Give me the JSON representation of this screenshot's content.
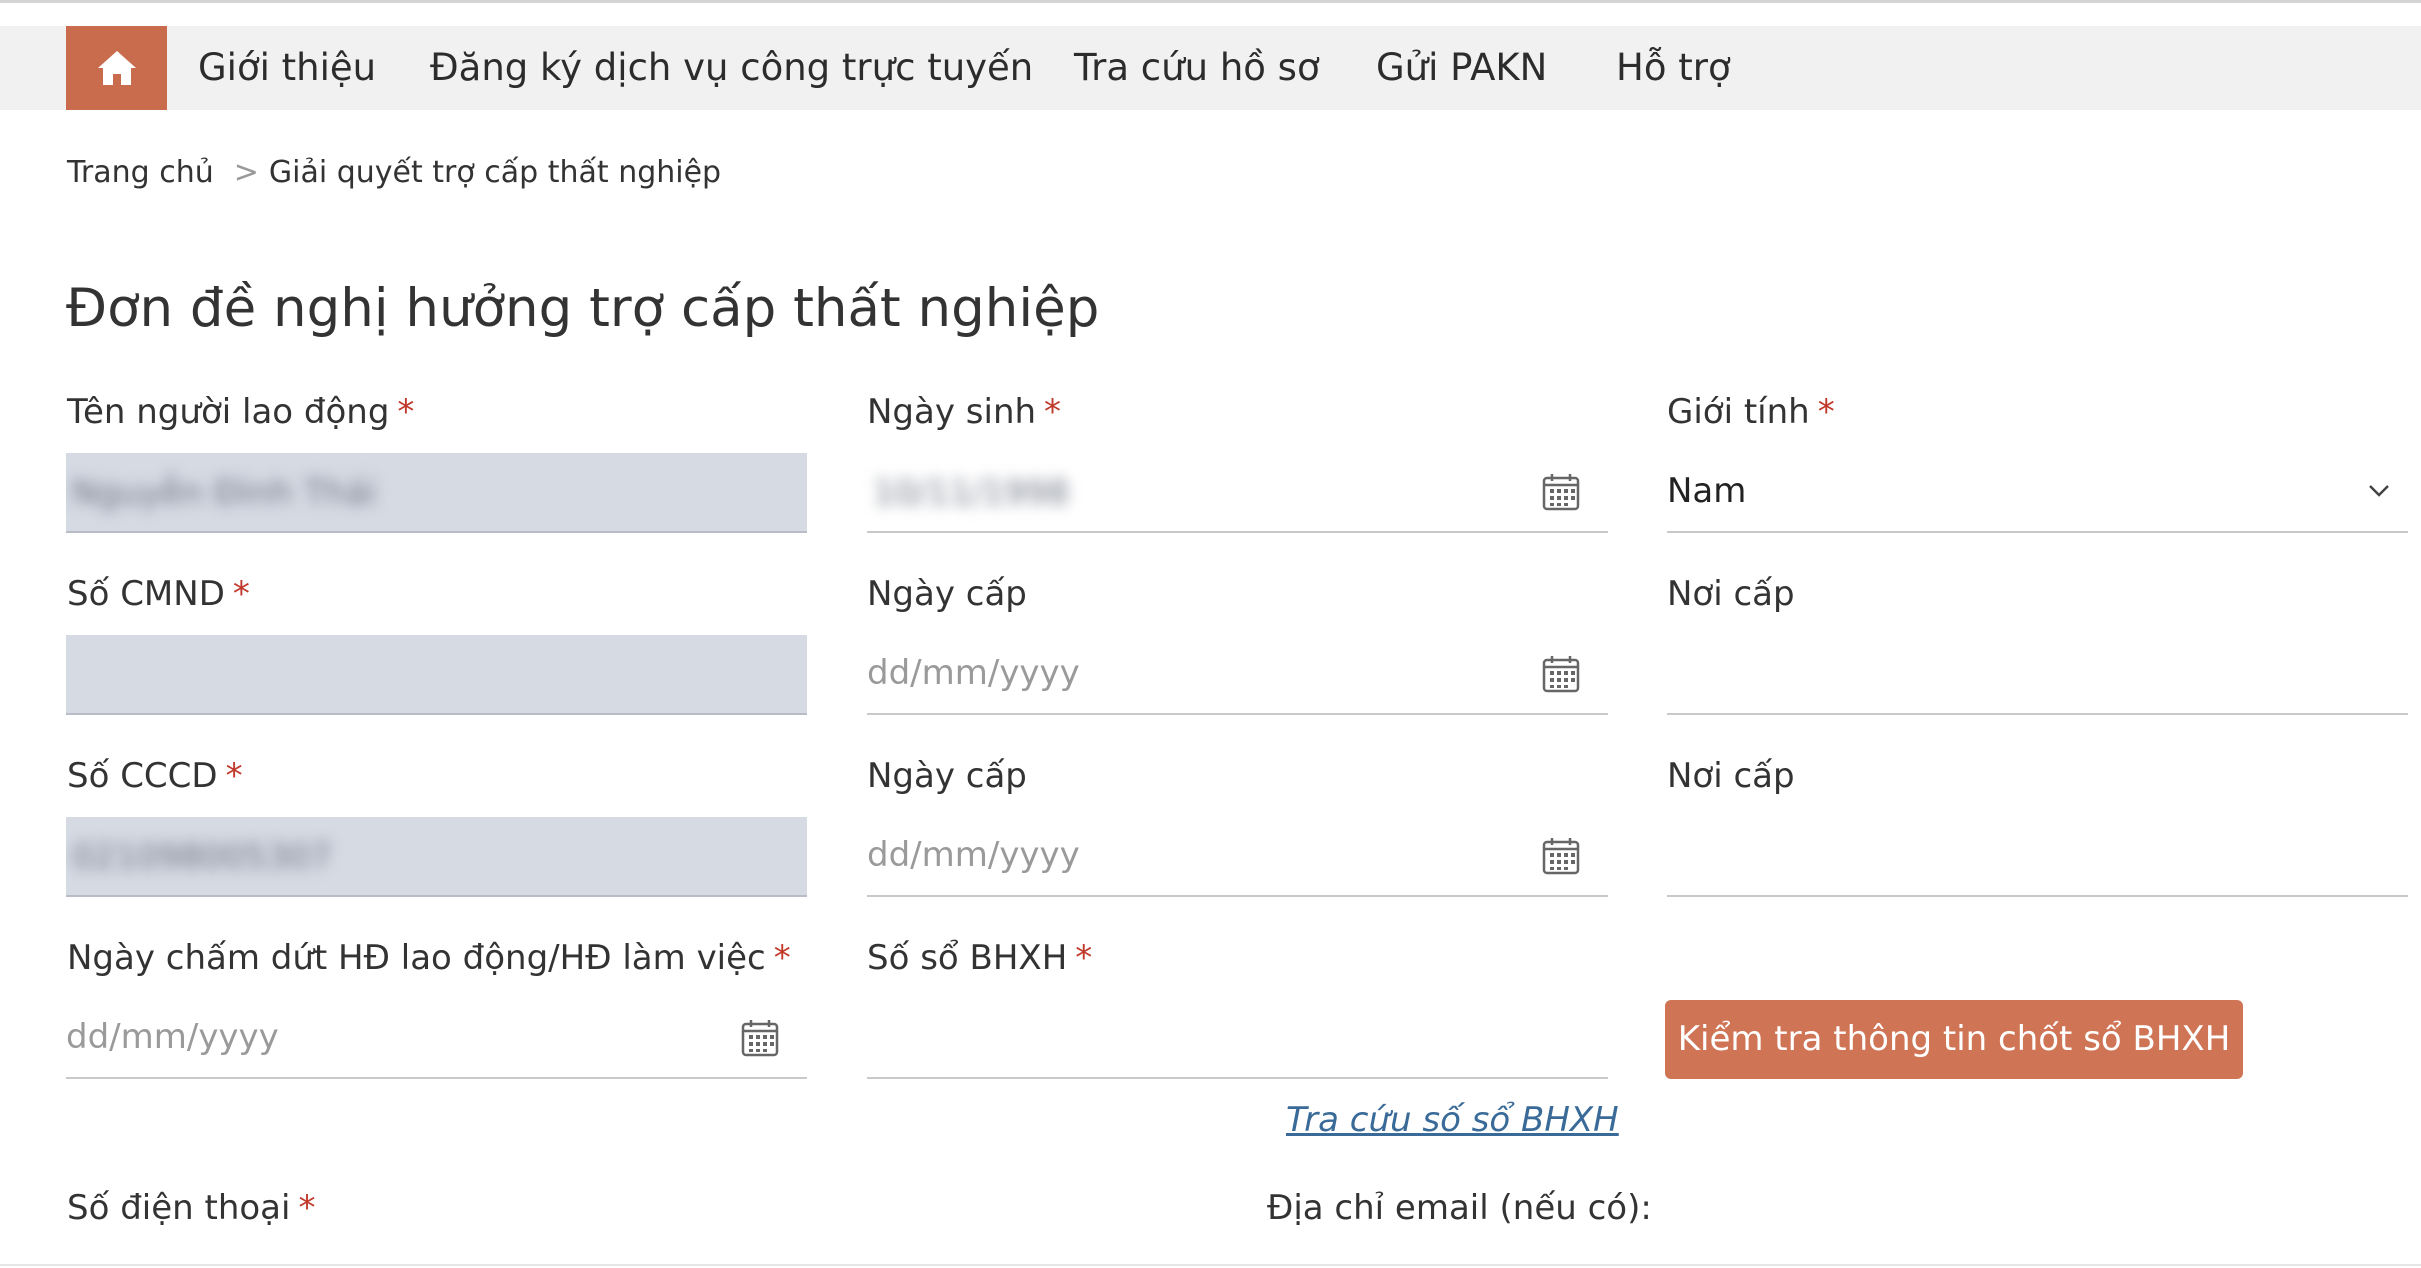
{
  "nav": {
    "items": [
      {
        "label": "Giới thiệu"
      },
      {
        "label": "Đăng ký dịch vụ công trực tuyến"
      },
      {
        "label": "Tra cứu hồ sơ"
      },
      {
        "label": "Gửi PAKN"
      },
      {
        "label": "Hỗ trợ"
      }
    ]
  },
  "breadcrumb": {
    "home": "Trang chủ",
    "separator": ">",
    "current": "Giải quyết trợ cấp thất nghiệp"
  },
  "form": {
    "title": "Đơn đề nghị hưởng trợ cấp thất nghiệp",
    "required_mark": "*",
    "fields": {
      "worker_name": {
        "label": "Tên người lao động",
        "value": "Nguyễn Đình Thái"
      },
      "birth_date": {
        "label": "Ngày sinh",
        "value": "10/11/1998"
      },
      "gender": {
        "label": "Giới tính",
        "value": "Nam"
      },
      "cmnd": {
        "label": "Số CMND",
        "value": ""
      },
      "cmnd_issue_date": {
        "label": "Ngày cấp",
        "placeholder": "dd/mm/yyyy"
      },
      "cmnd_issue_place": {
        "label": "Nơi cấp",
        "value": ""
      },
      "cccd": {
        "label": "Số CCCD",
        "value": "021098005307"
      },
      "cccd_issue_date": {
        "label": "Ngày cấp",
        "placeholder": "dd/mm/yyyy"
      },
      "cccd_issue_place": {
        "label": "Nơi cấp",
        "value": ""
      },
      "contract_end_date": {
        "label": "Ngày chấm dứt HĐ lao động/HĐ làm việc",
        "placeholder": "dd/mm/yyyy"
      },
      "bhxh_number": {
        "label": "Số sổ BHXH",
        "value": ""
      },
      "phone": {
        "label": "Số điện thoại"
      },
      "email": {
        "label": "Địa chỉ email (nếu có):"
      }
    },
    "check_button": "Kiểm tra thông tin chốt sổ BHXH",
    "lookup_link": "Tra cứu số sổ BHXH"
  },
  "colors": {
    "accent": "#cf7556",
    "home_bg": "#c96c4e",
    "nav_bg": "#f1f1f1",
    "filled_input_bg": "#d5dae3",
    "required": "#c0392b",
    "link": "#3a6b98"
  },
  "icons": {
    "home": "home-icon",
    "calendar": "calendar-icon",
    "dropdown": "chevron-down-icon"
  }
}
